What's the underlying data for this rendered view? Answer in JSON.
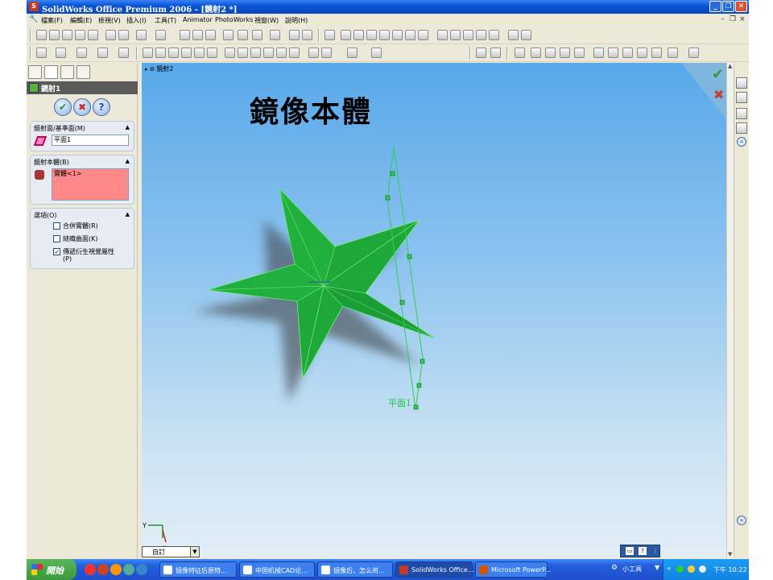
{
  "window": {
    "title": "SolidWorks Office Premium 2006 - [鏡射2 *]"
  },
  "menu": [
    "檔案(F)",
    "編輯(E)",
    "檢視(V)",
    "插入(I)",
    "工具(T)",
    "Animator",
    "PhotoWorks",
    "視窗(W)",
    "說明(H)"
  ],
  "panel": {
    "feature_title": "鏡射1",
    "mirror_face_header": "鏡射面/基準面(M)",
    "mirror_face_value": "平面1",
    "bodies_header": "鏡射本體(B)",
    "bodies_value": "實體<1>",
    "options_header": "選項(O)",
    "options": [
      {
        "label": "合併實體(R)",
        "checked": false
      },
      {
        "label": "縫織曲面(K)",
        "checked": false
      },
      {
        "label": "傳遞衍生視覺屬性",
        "sub": "(P)",
        "checked": true
      }
    ],
    "ok_glyph": "✔",
    "cancel_glyph": "✖",
    "help_glyph": "?"
  },
  "graphics": {
    "tree_label": "鏡射2",
    "heading": "鏡像本體",
    "plane_label": "平面1",
    "view_dropdown": "自訂",
    "accent_star": "#1fa83a",
    "accent_plane": "#2fd04c"
  },
  "taskbar": {
    "start": "開始",
    "tasks": [
      "镜像特征后原特...",
      "中国机械CAD论...",
      "镜像后，怎么将...",
      "SolidWorks Office...",
      "Microsoft PowerP..."
    ],
    "tray_tool": "小工具",
    "clock": "下午 10:22"
  }
}
